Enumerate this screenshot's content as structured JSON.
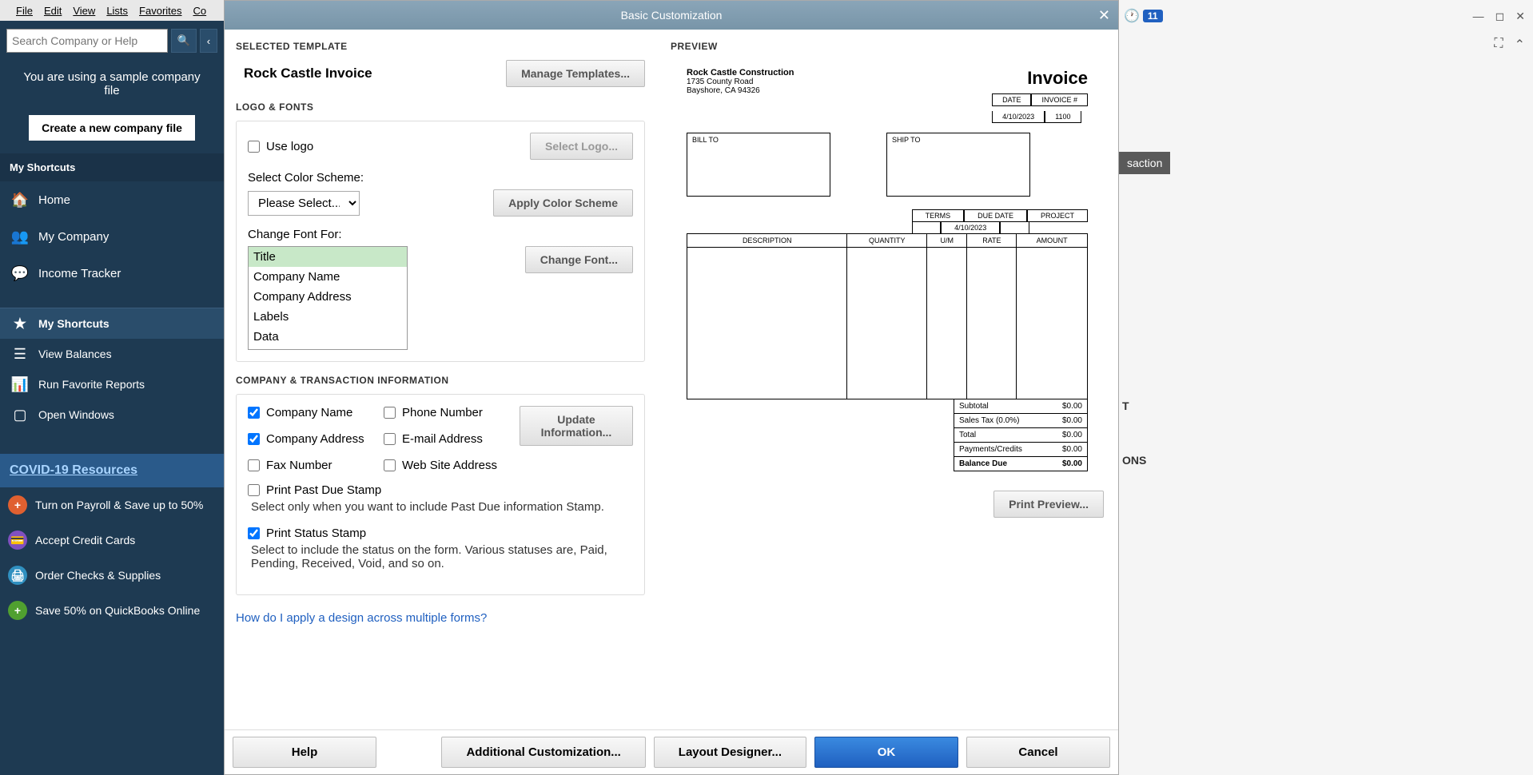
{
  "menubar": [
    "File",
    "Edit",
    "View",
    "Lists",
    "Favorites",
    "Co"
  ],
  "search": {
    "placeholder": "Search Company or Help"
  },
  "sample_msg": "You are using a sample company file",
  "create_btn": "Create a new company file",
  "shortcuts_header": "My Shortcuts",
  "nav": [
    {
      "icon": "🏠",
      "label": "Home"
    },
    {
      "icon": "👥",
      "label": "My Company"
    },
    {
      "icon": "💬",
      "label": "Income Tracker"
    }
  ],
  "bottom_nav": [
    {
      "label": "My Shortcuts",
      "active": true
    },
    {
      "label": "View Balances"
    },
    {
      "label": "Run Favorite Reports"
    },
    {
      "label": "Open Windows"
    }
  ],
  "covid": "COVID-19 Resources",
  "promos": [
    {
      "icon": "+",
      "color": "#e06030",
      "label": "Turn on Payroll & Save up to 50%"
    },
    {
      "icon": "💳",
      "color": "#8050c0",
      "label": "Accept Credit Cards"
    },
    {
      "icon": "🖨",
      "color": "#3090c0",
      "label": "Order Checks & Supplies"
    },
    {
      "icon": "+",
      "color": "#50a030",
      "label": "Save 50% on QuickBooks Online"
    }
  ],
  "clock_badge": "11",
  "partial_tab": "saction",
  "partial_t": "T",
  "partial_ons": "ONS",
  "dialog": {
    "title": "Basic Customization",
    "selected_template_label": "SELECTED TEMPLATE",
    "template_name": "Rock Castle Invoice",
    "manage_templates": "Manage Templates...",
    "logo_fonts_label": "LOGO & FONTS",
    "use_logo": "Use logo",
    "select_logo": "Select Logo...",
    "color_scheme_label": "Select Color Scheme:",
    "color_scheme_value": "Please Select...",
    "apply_color": "Apply Color Scheme",
    "change_font_label": "Change Font For:",
    "font_options": [
      "Title",
      "Company Name",
      "Company Address",
      "Labels",
      "Data"
    ],
    "change_font_btn": "Change Font...",
    "company_info_label": "COMPANY & TRANSACTION INFORMATION",
    "checks": {
      "company_name": "Company Name",
      "phone": "Phone Number",
      "company_address": "Company Address",
      "email": "E-mail Address",
      "fax": "Fax Number",
      "website": "Web Site Address"
    },
    "update_info": "Update Information...",
    "past_due": "Print Past Due Stamp",
    "past_due_desc": "Select only when you want to include Past Due information Stamp.",
    "status_stamp": "Print Status Stamp",
    "status_desc": "Select to include the status on the form. Various statuses are, Paid, Pending, Received, Void, and so on.",
    "help_link": "How do I apply a design across multiple forms?",
    "preview_label": "PREVIEW",
    "print_preview": "Print Preview...",
    "footer": {
      "help": "Help",
      "additional": "Additional Customization...",
      "layout": "Layout Designer...",
      "ok": "OK",
      "cancel": "Cancel"
    }
  },
  "invoice": {
    "company": "Rock Castle Construction",
    "addr1": "1735 County Road",
    "addr2": "Bayshore, CA 94326",
    "title": "Invoice",
    "date_label": "DATE",
    "invoice_num_label": "INVOICE #",
    "date": "4/10/2023",
    "num": "1100",
    "bill_to": "BILL TO",
    "ship_to": "SHIP TO",
    "terms": "TERMS",
    "due_date_label": "DUE DATE",
    "due_date": "4/10/2023",
    "project": "PROJECT",
    "cols": [
      "DESCRIPTION",
      "QUANTITY",
      "U/M",
      "RATE",
      "AMOUNT"
    ],
    "subtotal": "Subtotal",
    "sales_tax": "Sales Tax  (0.0%)",
    "total": "Total",
    "payments": "Payments/Credits",
    "balance": "Balance Due",
    "zero": "$0.00"
  }
}
